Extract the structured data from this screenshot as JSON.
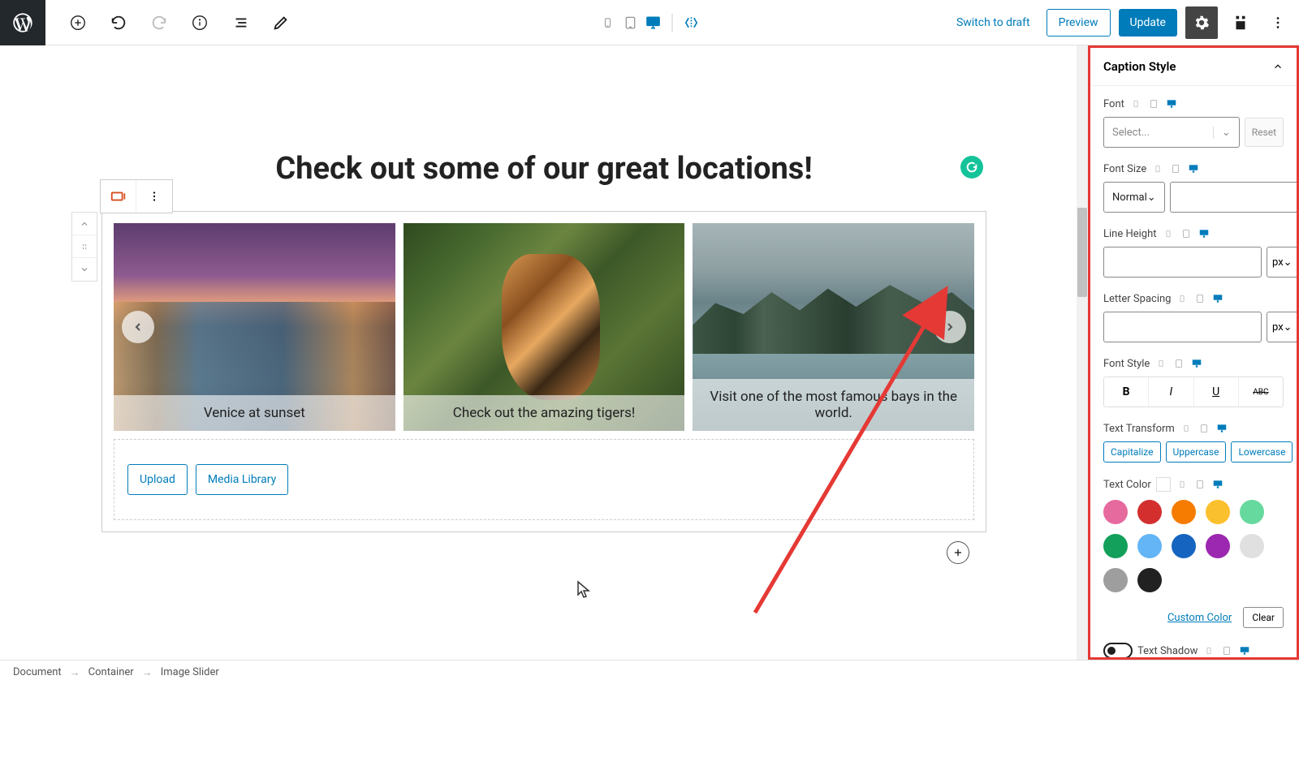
{
  "topbar": {
    "switch_to_draft": "Switch to draft",
    "preview": "Preview",
    "update": "Update"
  },
  "canvas": {
    "heading": "Check out some of our great locations!",
    "slides": [
      {
        "caption": "Venice at sunset"
      },
      {
        "caption": "Check out the amazing tigers!"
      },
      {
        "caption": "Visit one of the most famous bays in the world."
      }
    ],
    "upload": "Upload",
    "media_library": "Media Library"
  },
  "sidebar": {
    "panel_title": "Caption Style",
    "font": {
      "label": "Font",
      "placeholder": "Select..."
    },
    "font_size": {
      "label": "Font Size",
      "value": "Normal"
    },
    "line_height": {
      "label": "Line Height",
      "unit": "px"
    },
    "letter_spacing": {
      "label": "Letter Spacing",
      "unit": "px"
    },
    "font_style": {
      "label": "Font Style"
    },
    "text_transform": {
      "label": "Text Transform",
      "options": [
        "Capitalize",
        "Uppercase",
        "Lowercase"
      ]
    },
    "text_color": {
      "label": "Text Color"
    },
    "custom_color": "Custom Color",
    "clear": "Clear",
    "text_shadow": {
      "label": "Text Shadow"
    },
    "reset": "Reset",
    "colors": [
      "#e66a9e",
      "#d32f2f",
      "#f57c00",
      "#fbc02d",
      "#66d99e",
      "#13a05a",
      "#64b5f6",
      "#1565c0",
      "#9c27b0",
      "#e0e0e0",
      "#9e9e9e",
      "#212121"
    ]
  },
  "breadcrumb": {
    "items": [
      "Document",
      "Container",
      "Image Slider"
    ]
  }
}
